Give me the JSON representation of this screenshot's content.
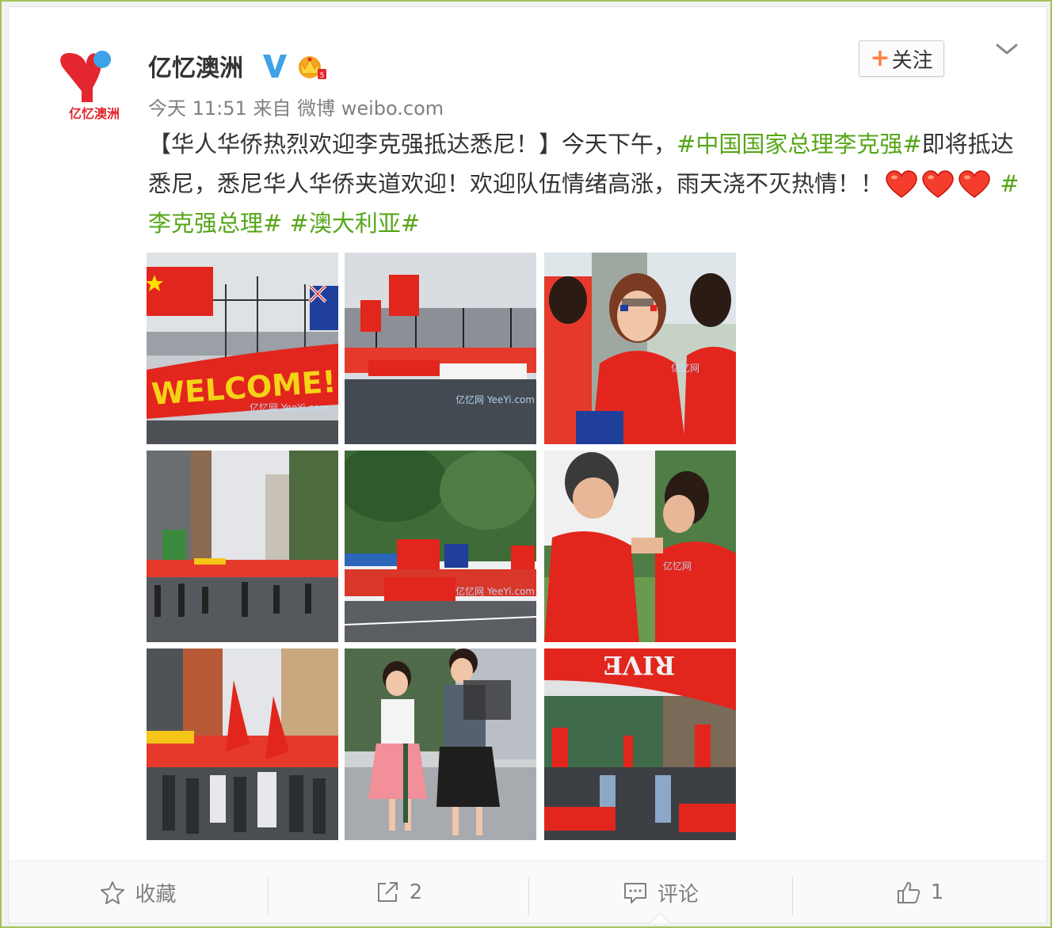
{
  "post": {
    "avatar_logo_text": "亿忆澳洲",
    "username": "亿忆澳洲",
    "badges": {
      "verified": "v-badge-icon",
      "member": "crown-icon"
    },
    "follow": {
      "plus": "+",
      "label": "关注"
    },
    "more": "chevron-down-icon",
    "meta": {
      "time": "今天 11:51",
      "from": "来自",
      "source": "微博 weibo.com"
    },
    "content": {
      "part1": "【华人华侨热烈欢迎李克强抵达悉尼！】今天下午，",
      "tag1": "#中国国家总理李克强#",
      "part2": "即将抵达悉尼，悉尼华人华侨夹道欢迎！欢迎队伍情绪高涨，雨天浇不灭热情！！",
      "tag2": "#李克强总理#",
      "tag3": "#澳大利亚#"
    },
    "photos": [
      {
        "name": "photo-welcome-banner",
        "banner_text": "WELCOME!",
        "watermark": "亿忆网 YeeYi.com"
      },
      {
        "name": "photo-crowd-by-fence",
        "watermark": "亿忆网 YeeYi.com"
      },
      {
        "name": "photo-woman-face-paint",
        "watermark": "亿忆网"
      },
      {
        "name": "photo-city-street-rain"
      },
      {
        "name": "photo-flags-banner-park",
        "watermark": "亿忆网 YeeYi.com"
      },
      {
        "name": "photo-face-painting",
        "watermark": "亿忆网"
      },
      {
        "name": "photo-street-flags-crowd"
      },
      {
        "name": "photo-girl-and-woman"
      },
      {
        "name": "photo-crowd-under-sign",
        "sign_text": "RIVE"
      }
    ]
  },
  "actions": {
    "favorite": {
      "icon": "star-icon",
      "label": "收藏"
    },
    "forward": {
      "icon": "share-icon",
      "count": "2"
    },
    "comment": {
      "icon": "comment-icon",
      "label": "评论"
    },
    "like": {
      "icon": "thumbs-up-icon",
      "count": "1"
    }
  },
  "colors": {
    "accent_green": "#56a618",
    "follow_plus": "#ff8140",
    "verified_blue": "#3da2e8",
    "logo_red": "#e4262e"
  }
}
